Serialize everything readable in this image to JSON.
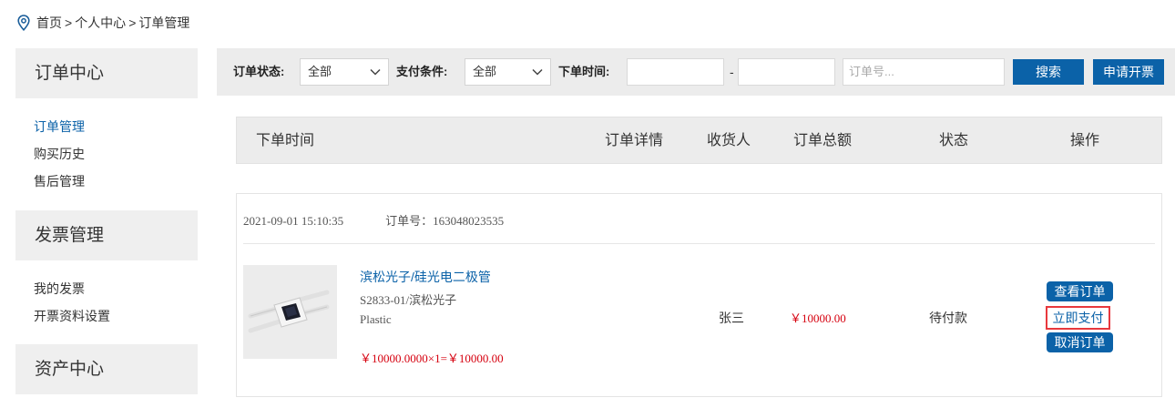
{
  "breadcrumb": {
    "items": [
      "首页",
      "个人中心",
      "订单管理"
    ],
    "separator": ">"
  },
  "sidebar": {
    "sections": [
      {
        "title": "订单中心",
        "links": [
          "订单管理",
          "购买历史",
          "售后管理"
        ]
      },
      {
        "title": "发票管理",
        "links": [
          "我的发票",
          "开票资料设置"
        ]
      },
      {
        "title": "资产中心",
        "links": []
      }
    ],
    "active_link": "订单管理"
  },
  "filters": {
    "status_label": "订单状态:",
    "status_value": "全部",
    "pay_label": "支付条件:",
    "pay_value": "全部",
    "time_label": "下单时间:",
    "time_from": "",
    "time_to": "",
    "time_sep": "-",
    "order_no_placeholder": "订单号...",
    "search_button": "搜索",
    "invoice_button": "申请开票"
  },
  "table": {
    "headers": [
      "下单时间",
      "订单详情",
      "收货人",
      "订单总额",
      "状态",
      "操作"
    ]
  },
  "orders": [
    {
      "datetime": "2021-09-01 15:10:35",
      "order_no_label": "订单号：",
      "order_no": "163048023535",
      "product_name": "滨松光子/硅光电二极管",
      "model": "S2833-01/滨松光子",
      "material": "Plastic",
      "price_line": "￥10000.0000×1=￥10000.00",
      "receiver": "张三",
      "total": "￥10000.00",
      "status": "待付款",
      "actions": [
        "查看订单",
        "立即支付",
        "取消订单"
      ]
    }
  ],
  "colors": {
    "accent": "#0b62a8",
    "price": "#d6000f",
    "highlight_border": "#e8383d",
    "panel_bg": "#ececec"
  },
  "icons": {
    "breadcrumb": "location-pin-icon",
    "select": "chevron-down-icon"
  }
}
